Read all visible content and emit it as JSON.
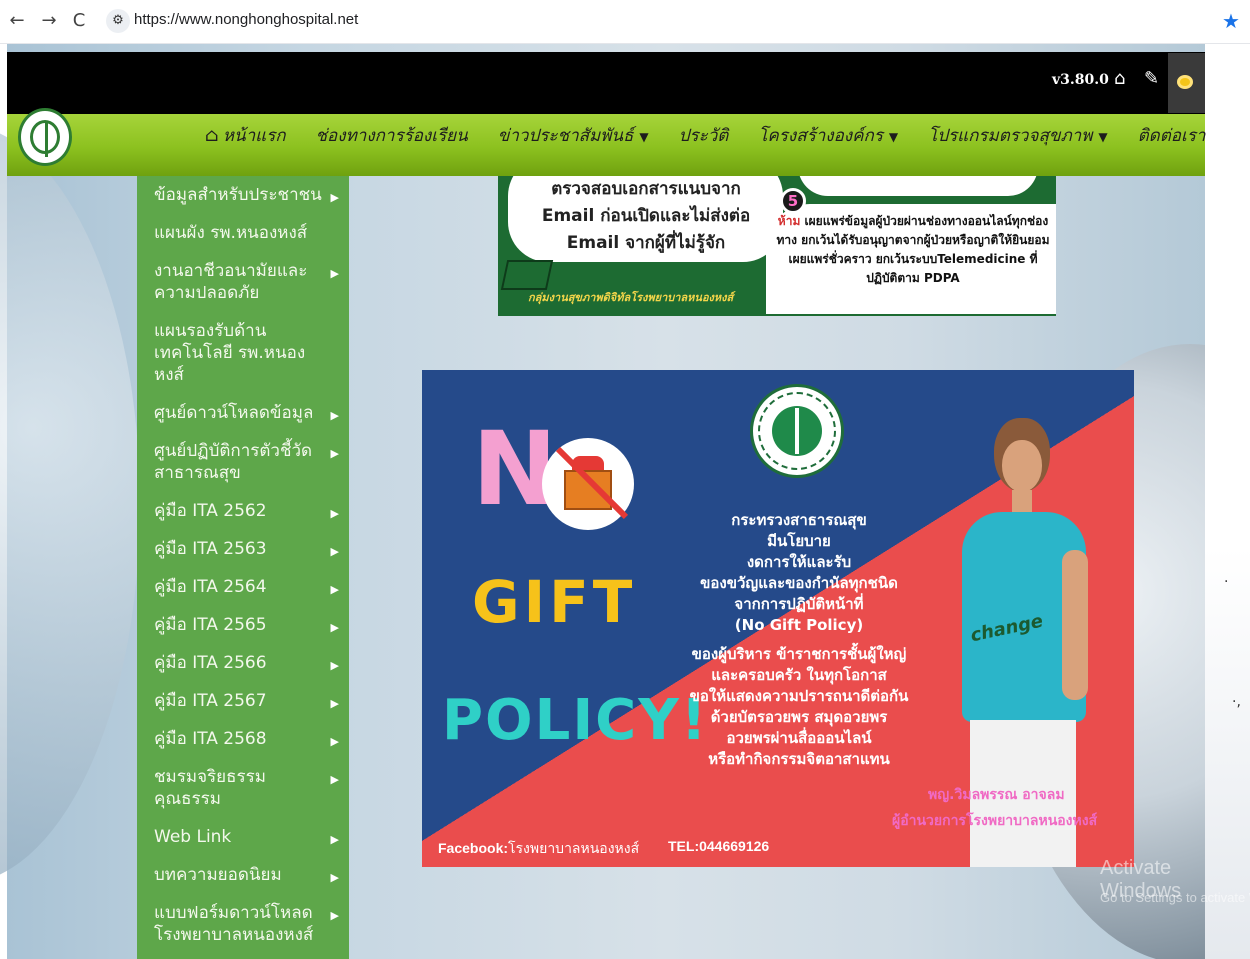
{
  "browser": {
    "back": "←",
    "forward": "→",
    "reload": "C",
    "url": "https://www.nonghonghospital.net",
    "bookmark": "★"
  },
  "topbar": {
    "version": "v3.80.0",
    "icons": [
      "home-icon",
      "pencil-icon",
      "eye-icon"
    ]
  },
  "nav": {
    "items": [
      {
        "label": "หน้าแรก",
        "icon": "home-icon"
      },
      {
        "label": "ช่องทางการร้องเรียน"
      },
      {
        "label": "ข่าวประชาสัมพันธ์",
        "dropdown": "▼"
      },
      {
        "label": "ประวัติ"
      },
      {
        "label": "โครงสร้างองค์กร",
        "dropdown": "▼"
      },
      {
        "label": "โปรแกรมตรวจสุขภาพ",
        "dropdown": "▼"
      },
      {
        "label": "ติดต่อเรา"
      }
    ]
  },
  "sidebar": {
    "items": [
      {
        "label": "ข้อมูลสำหรับประชาชน",
        "arrow": "▶"
      },
      {
        "label": "แผนผัง รพ.หนองหงส์",
        "arrow": ""
      },
      {
        "label": "งานอาชีวอนามัยและความปลอดภัย",
        "arrow": "▶"
      },
      {
        "label": "แผนรองรับด้านเทคโนโลยี รพ.หนองหงส์",
        "arrow": ""
      },
      {
        "label": "ศูนย์ดาวน์โหลดข้อมูล",
        "arrow": "▶"
      },
      {
        "label": "ศูนย์ปฏิบัติการตัวชี้วัดสาธารณสุข",
        "arrow": "▶"
      },
      {
        "label": "คู่มือ ITA 2562",
        "arrow": "▶"
      },
      {
        "label": "คู่มือ ITA 2563",
        "arrow": "▶"
      },
      {
        "label": "คู่มือ ITA 2564",
        "arrow": "▶"
      },
      {
        "label": "คู่มือ ITA 2565",
        "arrow": "▶"
      },
      {
        "label": "คู่มือ ITA 2566",
        "arrow": "▶"
      },
      {
        "label": "คู่มือ ITA 2567",
        "arrow": "▶"
      },
      {
        "label": "คู่มือ ITA 2568",
        "arrow": "▶"
      },
      {
        "label": "ชมรมจริยธรรมคุณธรรม",
        "arrow": "▶"
      },
      {
        "label": "Web Link",
        "arrow": "▶"
      },
      {
        "label": "บทความยอดนิยม",
        "arrow": "▶"
      },
      {
        "label": "แบบฟอร์มดาวน์โหลดโรงพยาบาลหนองหงส์",
        "arrow": "▶"
      }
    ]
  },
  "banner_top": {
    "left_text": [
      "ตรวจสอบเอกสารแนบจาก",
      "Email ก่อนเปิดและไม่ส่งต่อ",
      "Email จากผู้ที่ไม่รู้จัก"
    ],
    "number": "5",
    "right_warn": "ห้าม",
    "right_text": "เผยแพร่ข้อมูลผู้ป่วยผ่านช่องทางออนไลน์ทุกช่องทาง ยกเว้นได้รับอนุญาตจากผู้ป่วยหรือญาติให้ยินยอมเผยแพร่ชั่วคราว ยกเว้นระบบTelemedicine ที่ปฏิบัติตาม PDPA",
    "caption": "กลุ่มงานสุขภาพดิจิทัลโรงพยาบาลหนองหงส์"
  },
  "poster": {
    "n_letter": "N",
    "gift": "GIFT",
    "policy": "POLICY!",
    "text_block_1": [
      "กระทรวงสาธารณสุข",
      "มีนโยบาย",
      "งดการให้และรับ",
      "ของขวัญและของกำนัลทุกชนิด",
      "จากการปฏิบัติหน้าที่",
      "(No Gift Policy)"
    ],
    "text_block_2": [
      "ของผู้บริหาร ข้าราชการชั้นผู้ใหญ่",
      "และครอบครัว ในทุกโอกาส",
      "ขอให้แสดงความปรารถนาดีต่อกัน",
      "ด้วยบัตรอวยพร สมุดอวยพร",
      "อวยพรผ่านสื่อออนไลน์",
      "หรือทำกิจกรรมจิตอาสาแทน"
    ],
    "shirt_text": "change",
    "director_name": "พญ.วิมลพรรณ อาจลม",
    "director_title": "ผู้อำนวยการโรงพยาบาลหนองหงส์",
    "facebook_label": "Facebook:",
    "facebook_name": "โรงพยาบาลหนองหงส์",
    "tel": "TEL:044669126"
  },
  "activate": {
    "title": "Activate Windows",
    "sub": "Go to Settings to activate Windows."
  }
}
